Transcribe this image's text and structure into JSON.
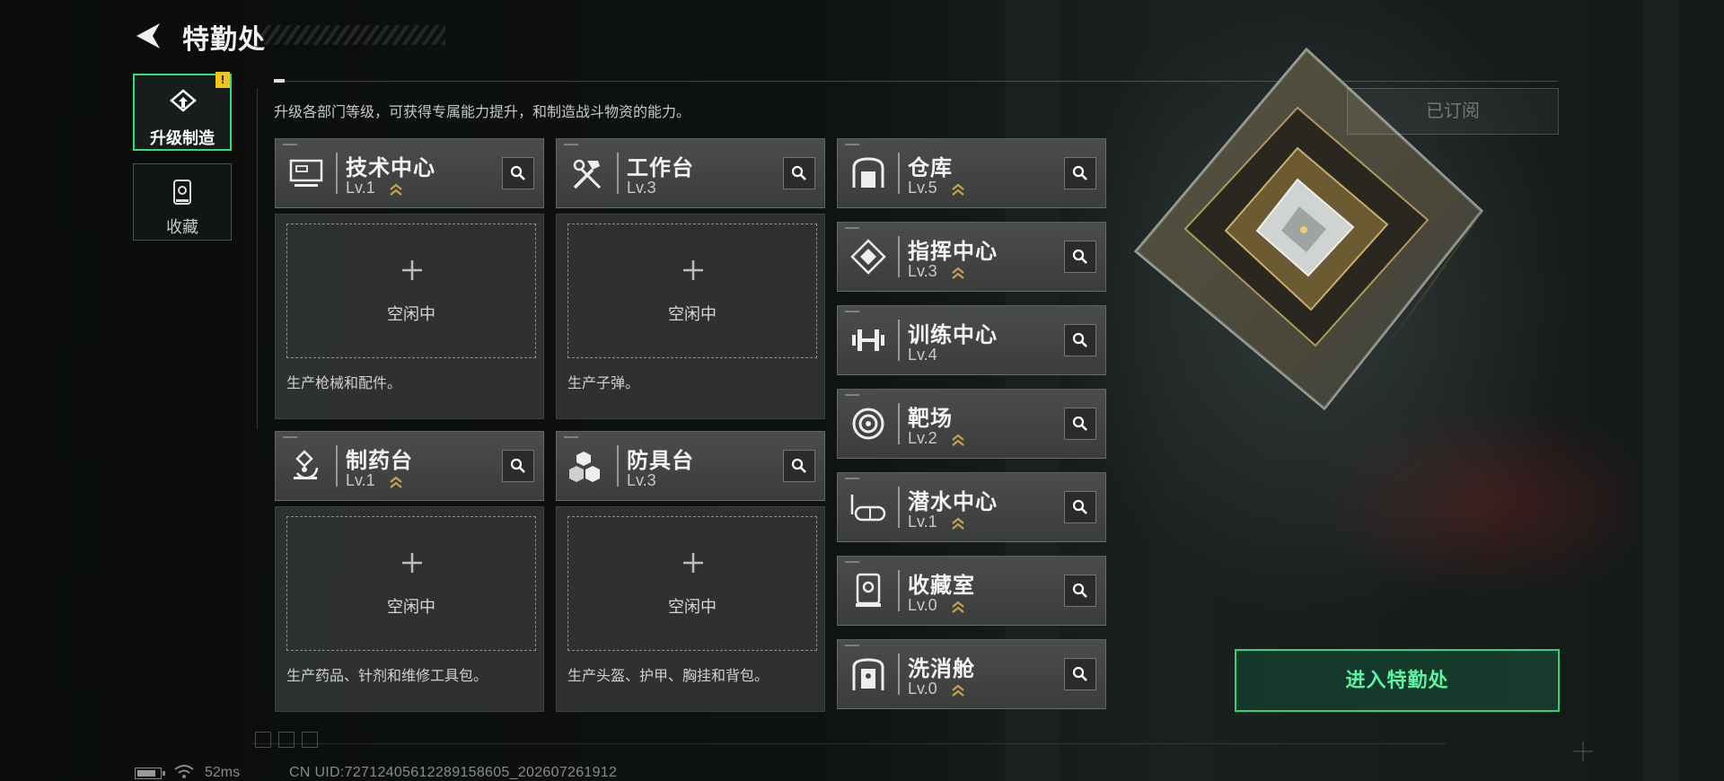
{
  "header": {
    "title": "特勤处",
    "subtitle": "升级各部门等级，可获得专属能力提升，和制造战斗物资的能力。"
  },
  "tabs": [
    {
      "label": "升级制造",
      "icon": "upgrade-build-icon",
      "active": true,
      "badge": "!"
    },
    {
      "label": "收藏",
      "icon": "collection-icon",
      "active": false
    }
  ],
  "production": [
    {
      "name": "技术中心",
      "level": "Lv.1",
      "icon": "computer-icon",
      "slot_status": "空闲中",
      "description": "生产枪械和配件。"
    },
    {
      "name": "工作台",
      "level": "Lv.3",
      "icon": "tools-icon",
      "slot_status": "空闲中",
      "description": "生产子弹。"
    },
    {
      "name": "制药台",
      "level": "Lv.1",
      "icon": "microscope-icon",
      "slot_status": "空闲中",
      "description": "生产药品、针剂和维修工具包。"
    },
    {
      "name": "防具台",
      "level": "Lv.3",
      "icon": "armor-blocks-icon",
      "slot_status": "空闲中",
      "description": "生产头盔、护甲、胸挂和背包。"
    }
  ],
  "facilities": [
    {
      "name": "仓库",
      "level": "Lv.5",
      "icon": "warehouse-icon"
    },
    {
      "name": "指挥中心",
      "level": "Lv.3",
      "icon": "command-icon"
    },
    {
      "name": "训练中心",
      "level": "Lv.4",
      "icon": "dumbbell-icon"
    },
    {
      "name": "靶场",
      "level": "Lv.2",
      "icon": "target-icon"
    },
    {
      "name": "潜水中心",
      "level": "Lv.1",
      "icon": "diving-mask-icon"
    },
    {
      "name": "收藏室",
      "level": "Lv.0",
      "icon": "collection-room-icon"
    },
    {
      "name": "洗消舱",
      "level": "Lv.0",
      "icon": "decon-chamber-icon"
    }
  ],
  "actions": {
    "subscribed": "已订阅",
    "enter": "进入特勤处"
  },
  "status": {
    "ping": "52ms",
    "uid": "CN UID:72712405612289158605_202607261912"
  },
  "colors": {
    "accent_green": "#2ee07a",
    "chevron_gold": "#c8a24a",
    "card_bg": "#434545",
    "badge_yellow": "#f0c419"
  }
}
